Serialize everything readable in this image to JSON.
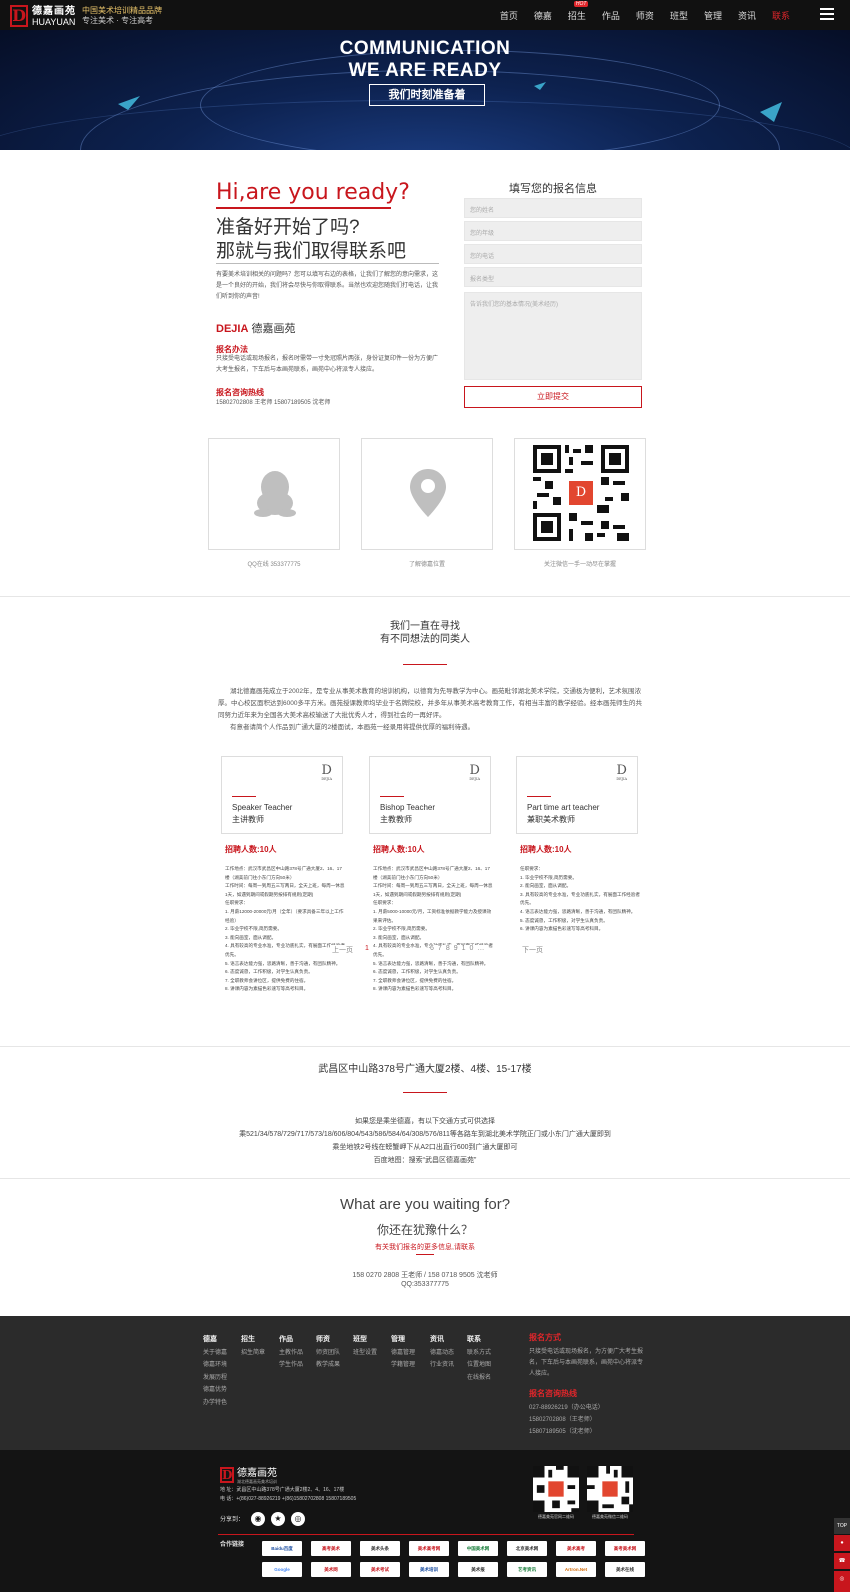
{
  "header": {
    "logo_name": "德嘉画苑",
    "logo_en": "HUAYUAN",
    "slogan_1": "中国美术培训精品品牌",
    "slogan_2": "专注美术 · 专注高考",
    "nav": [
      {
        "label": "首页"
      },
      {
        "label": "德嘉"
      },
      {
        "label": "招生",
        "badge": "HOT"
      },
      {
        "label": "作品"
      },
      {
        "label": "师资"
      },
      {
        "label": "班型"
      },
      {
        "label": "管理"
      },
      {
        "label": "资讯"
      },
      {
        "label": "联系",
        "active": true
      }
    ]
  },
  "banner": {
    "line1": "COMMUNICATION",
    "line2": "WE ARE READY",
    "button": "我们时刻准备着"
  },
  "intro": {
    "hi": "Hi,are you ready?",
    "cn1": "准备好开始了吗?",
    "cn2": "那就与我们取得联系吧",
    "body": "有要美术培训相关的问题吗？您可以填写右边的表格，让我们了解您的意向需求，这是一个良好的开始，我们将会尽快与你取得联系。当然也欢迎您随我们打电话，让我们听到你的声音!",
    "brand_en": "DEJIA",
    "brand_cn": "德嘉画苑",
    "method_title": "报名办法",
    "method_text": "只接受电话或现场报名，报名时需带一寸免冠照片两张，身份证复印件一份为方便广大考生报名，下车后与本画苑联系，画苑中心将派专人接应。",
    "hotline_title": "报名咨询热线",
    "hotline_text": "15802702808 王老师 15807189505 沈老师"
  },
  "form": {
    "title": "填写您的报名信息",
    "name_ph": "您的姓名",
    "age_ph": "您的年级",
    "phone_ph": "您的电话",
    "class_ph": "报名类型",
    "msg_ph": "告诉我们您的基本情况(美术经历)",
    "submit": "立即提交"
  },
  "contact_cards": [
    {
      "icon": "qq-icon",
      "caption": "QQ在线 353377775"
    },
    {
      "icon": "location-icon",
      "caption": "了解德嘉位置"
    },
    {
      "icon": "qr-code",
      "caption": "关注微信一手一动尽在掌握"
    }
  ],
  "recruit": {
    "title1": "我们一直在寻找",
    "title2": "有不同想法的同类人",
    "about_1": "湖北德嘉画苑成立于2002年，是专业从事美术教育的培训机构，以德育为先导教学为中心。画苑毗邻湖北美术学院，交通极为便利，艺术氛围浓厚。中心校区面积达到6000多平方米。画苑授课教师均毕业于名牌院校，并多年从事美术高考教育工作，有相当丰富的教学经验。经本画苑师生的共同努力近年来为全国各大美术高校输送了大批优秀人才，得到社会的一再好评。",
    "about_2": "有意者请简个人作品到广通大厦的2楼面试，本画苑一经录用将提供优厚的福利待遇。",
    "jobs": [
      {
        "en": "Speaker Teacher",
        "cn": "主讲教师",
        "count": "招聘人数:10人",
        "text": "工作地点：武汉市武昌区中山路378号广通大厦2、16、17楼（湖美前门往小东门方向50米）\n工作时间：每周一到周五三写两日，全天上班，每周一休息1天，如遇到期间或假期另按排有规则(定期)\n任职要求：\n1. 月薪12000-20000元/月（全年）（要求具备三年以上工作经验）\n2. 毕业学校不限,简历需要。\n3. 能向画室，面从调配。\n4. 具有较高的专业水准，专业功底扎实，有展面工作经验者优先。\n5. 语言表达能力强，思路清晰，善于沟通，有团队精神。\n6. 态度诚恳，工作积极，对学生认真负责。\n7. 全职教师会讲位区，提供免费的住宿。\n8. 讲课内容为素描色彩速写等高考科目。"
      },
      {
        "en": "Bishop Teacher",
        "cn": "主教教师",
        "count": "招聘人数:10人",
        "text": "工作地点：武汉市武昌区中山路378号广通大厦2、16、17楼（湖美前门往小东门方向50米）\n工作时间：每周一到周五三写两日，全天上班，每周一休息1天，如遇到期间或假期另按排有规则(定期)\n任职要求：\n1. 月薪5000-10000元/月，工资标准依据教学能力及授课效果来评估。\n2. 毕业学校不限,简历需要。\n3. 能向画室，面从调配。\n4. 具有较高的专业水准，专业功底扎实，有展面工作经验者优先。\n5. 语言表达能力强，思路清晰，善于沟通，有团队精神。\n6. 态度诚恳，工作积极，对学生认真负责。\n7. 全职教师会讲位区，提供免费的住宿。\n8. 讲课内容为素描色彩速写等高考科目。"
      },
      {
        "en": "Part time art teacher",
        "cn": "兼职美术教师",
        "count": "招聘人数:10人",
        "text": "任职要求：\n1. 毕业学校不限,简历需要。\n2. 能向画室，面从调配。\n3. 具有较高的专业水准，专业功底扎实，有展面工作经验者优先。\n4. 语言表达能力强，思路清晰，善于沟通，有团队精神。\n5. 态度诚恳，工作积极，对学生认真负责。\n6. 讲课内容为素描色彩速写等高考科目。"
      }
    ],
    "prev": "上一页",
    "next": "下一页",
    "pages": [
      "1",
      "2",
      "3",
      "4",
      "5",
      "6",
      "7",
      "8",
      "9",
      "10",
      "…"
    ]
  },
  "address": {
    "title": "武昌区中山路378号广通大厦2楼、4楼、15-17楼",
    "line1": "如果您是乘坐德嘉，有以下交通方式可供选择",
    "line2": "乘521/34/578/729/717/573/18/606/804/543/586/584/64/308/576/811等各路车到湖北美术学院正门或小东门广通大厦即到",
    "line3": "乘坐地铁2号线在螃蟹岬下从A2口出直行600到广通大厦即可",
    "line4": "百度地图：搜索“武昌区德嘉画苑”"
  },
  "cta": {
    "title": "What are you waiting for?",
    "cn": "你还在犹豫什么？",
    "link": "有关我们报名的更多信息,请联系",
    "phones": "158 0270 2808 王老师 / 158 0718 9505 沈老师",
    "qq": "QQ:353377775"
  },
  "footer": {
    "cols": [
      {
        "head": "德嘉",
        "items": [
          "关于德嘉",
          "德嘉环境",
          "发展历程",
          "德嘉优势",
          "办学特色"
        ]
      },
      {
        "head": "招生",
        "items": [
          "招生简章"
        ]
      },
      {
        "head": "作品",
        "items": [
          "主教作品",
          "学生作品"
        ]
      },
      {
        "head": "师资",
        "items": [
          "师资团队",
          "教学成果"
        ]
      },
      {
        "head": "班型",
        "items": [
          "班型设置"
        ]
      },
      {
        "head": "管理",
        "items": [
          "德嘉管理",
          "学籍管理"
        ]
      },
      {
        "head": "资讯",
        "items": [
          "德嘉动态",
          "行业资讯"
        ]
      },
      {
        "head": "联系",
        "items": [
          "联系方式",
          "位置地图",
          "在线报名"
        ]
      }
    ],
    "signup_title": "报名方式",
    "signup_text": "只接受电话或现场报名，为方便广大考生报名，下车后与本画苑联系，画苑中心将派专人接应。",
    "hotline_title": "报名咨询热线",
    "hotlines": [
      "027-88926219（办公电话）",
      "15802702808（王老师）",
      "15807189505（沈老师）"
    ],
    "logo_name": "德嘉画苑",
    "logo_sub": "湖北德嘉画苑美术培训",
    "address": "地 址：武昌区中山路378号广通大厦2楼2、4、16、17楼",
    "phone": "电 话：+(86)027-88926219 +(86)15802702808 15807189505",
    "share_label": "分享到：",
    "qr1_caption": "德嘉美苑官网二维码",
    "qr2_caption": "德嘉美苑微信二维码",
    "partners_label": "合作链接",
    "partners": [
      "Baidu百度",
      "高考美术",
      "美术头条",
      "美术高考网",
      "中国美术网",
      "北京美术网",
      "美术高考",
      "高考美术网",
      "Google",
      "美术网",
      "美术考试",
      "美术培训",
      "美术报",
      "艺考资讯",
      "Artron.Net",
      "美术在线"
    ],
    "side_top": "TOP"
  }
}
